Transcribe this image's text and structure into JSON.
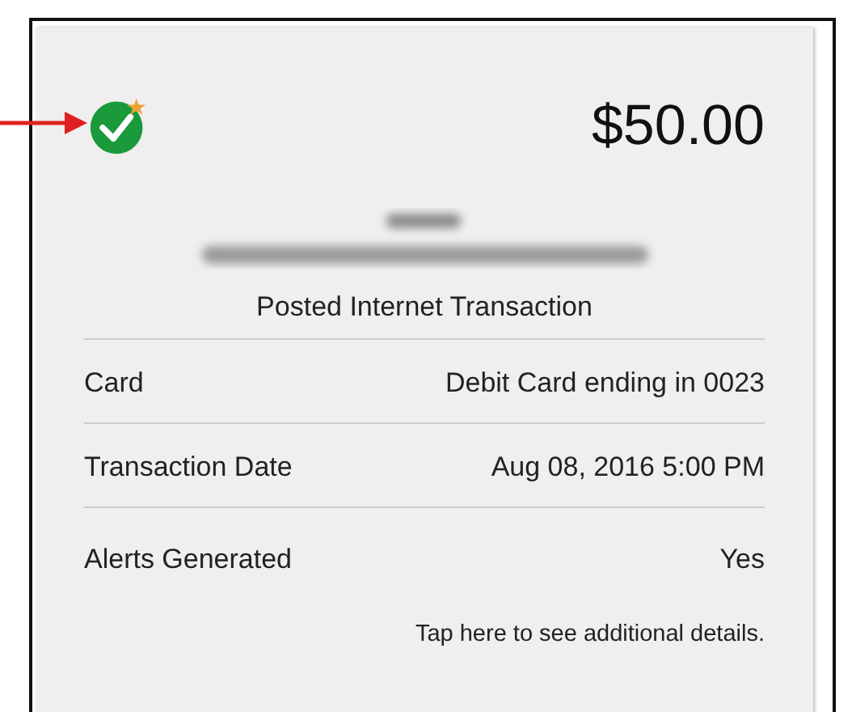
{
  "amount": "$50.00",
  "status": "Posted Internet Transaction",
  "details": [
    {
      "label": "Card",
      "value": "Debit Card ending in 0023"
    },
    {
      "label": "Transaction Date",
      "value": "Aug 08, 2016 5:00 PM"
    },
    {
      "label": "Alerts Generated",
      "value": "Yes"
    }
  ],
  "footer_link": "Tap here to see additional details."
}
